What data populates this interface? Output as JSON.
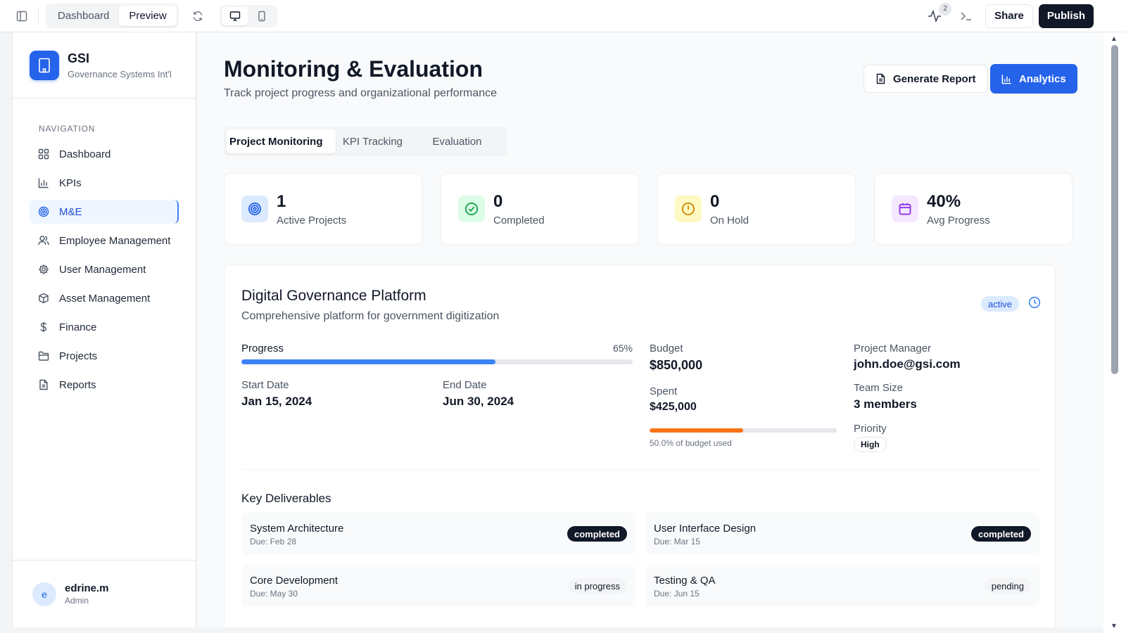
{
  "topbar": {
    "tabs": [
      "Dashboard",
      "Preview"
    ],
    "active_tab": "Preview",
    "notifications": "2",
    "share_label": "Share",
    "publish_label": "Publish"
  },
  "brand": {
    "name": "GSI",
    "subtitle": "Governance Systems Int'l"
  },
  "sidebar": {
    "section_title": "NAVIGATION",
    "items": [
      {
        "label": "Dashboard",
        "icon": "grid-icon"
      },
      {
        "label": "KPIs",
        "icon": "bar-chart-icon"
      },
      {
        "label": "M&E",
        "icon": "target-icon"
      },
      {
        "label": "Employee Management",
        "icon": "users-icon"
      },
      {
        "label": "User Management",
        "icon": "gear-icon"
      },
      {
        "label": "Asset Management",
        "icon": "box-icon"
      },
      {
        "label": "Finance",
        "icon": "dollar-icon"
      },
      {
        "label": "Projects",
        "icon": "folder-icon"
      },
      {
        "label": "Reports",
        "icon": "file-icon"
      }
    ],
    "active_item": "M&E"
  },
  "user": {
    "initial": "e",
    "name": "edrine.m",
    "role": "Admin"
  },
  "page": {
    "title": "Monitoring & Evaluation",
    "subtitle": "Track project progress and organizational performance",
    "generate_report_label": "Generate Report",
    "analytics_label": "Analytics"
  },
  "tabs": [
    "Project Monitoring",
    "KPI Tracking",
    "Evaluation"
  ],
  "active_tab": "Project Monitoring",
  "stats": [
    {
      "value": "1",
      "label": "Active Projects",
      "icon": "target-icon",
      "color": "#2563eb",
      "bg": "#dbeafe"
    },
    {
      "value": "0",
      "label": "Completed",
      "icon": "check-circle-icon",
      "color": "#16a34a",
      "bg": "#dcfce7"
    },
    {
      "value": "0",
      "label": "On Hold",
      "icon": "alert-circle-icon",
      "color": "#ca8a04",
      "bg": "#fef9c3"
    },
    {
      "value": "40%",
      "label": "Avg Progress",
      "icon": "calendar-icon",
      "color": "#9333ea",
      "bg": "#f3e8ff"
    }
  ],
  "project": {
    "title": "Digital Governance Platform",
    "description": "Comprehensive platform for government digitization",
    "status": "active",
    "progress_label": "Progress",
    "progress_text": "65%",
    "progress_value": 0.65,
    "start_label": "Start Date",
    "start_date": "Jan 15, 2024",
    "end_label": "End Date",
    "end_date": "Jun 30, 2024",
    "budget_label": "Budget",
    "budget": "$850,000",
    "spent_label": "Spent",
    "spent": "$425,000",
    "budget_used_value": 0.5,
    "budget_used_text": "50.0% of budget used",
    "manager_label": "Project Manager",
    "manager": "john.doe@gsi.com",
    "team_label": "Team Size",
    "team": "3 members",
    "priority_label": "Priority",
    "priority": "High",
    "deliverables_title": "Key Deliverables",
    "deliverables": [
      {
        "name": "System Architecture",
        "due": "Due: Feb 28",
        "status": "completed"
      },
      {
        "name": "User Interface Design",
        "due": "Due: Mar 15",
        "status": "completed"
      },
      {
        "name": "Core Development",
        "due": "Due: May 30",
        "status": "in progress"
      },
      {
        "name": "Testing & QA",
        "due": "Due: Jun 15",
        "status": "pending"
      }
    ]
  }
}
